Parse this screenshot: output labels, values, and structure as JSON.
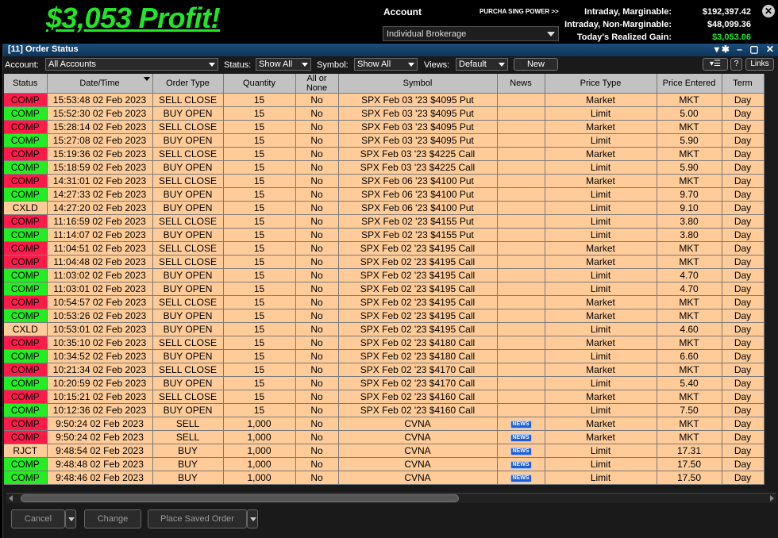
{
  "banner": {
    "profit_text": "$3,053 Profit!"
  },
  "account": {
    "title": "Account",
    "purchasing_power": "PURCHA SING POWER >>",
    "selected": "Individual Brokerage",
    "metrics": [
      {
        "label": "Intraday, Marginable:",
        "value": "$192,397.42"
      },
      {
        "label": "Intraday, Non-Marginable:",
        "value": "$48,099.36"
      },
      {
        "label": "Today's Realized Gain:",
        "value": "$3,053.06"
      }
    ]
  },
  "window": {
    "title": "[11] Order Status",
    "icons": "▾✱ – ▢ ✕"
  },
  "toolbar": {
    "account_label": "Account:",
    "account_value": "All Accounts",
    "status_label": "Status:",
    "status_value": "Show All",
    "symbol_label": "Symbol:",
    "symbol_value": "Show All",
    "views_label": "Views:",
    "views_value": "Default",
    "new_button": "New",
    "help_button": "?",
    "links_button": "Links"
  },
  "columns": [
    "Status",
    "Date/Time",
    "Order Type",
    "Quantity",
    "All or None",
    "Symbol",
    "News",
    "Price Type",
    "Price Entered",
    "Term"
  ],
  "rows": [
    {
      "status": "COMP",
      "color": "red",
      "time": "15:53:48 02 Feb 2023",
      "type": "SELL CLOSE",
      "qty": "15",
      "aon": "No",
      "symbol": "SPX Feb 03 '23 $4095 Put",
      "news": "",
      "ptype": "Market",
      "price": "MKT",
      "term": "Day"
    },
    {
      "status": "COMP",
      "color": "green",
      "time": "15:52:30 02 Feb 2023",
      "type": "BUY OPEN",
      "qty": "15",
      "aon": "No",
      "symbol": "SPX Feb 03 '23 $4095 Put",
      "news": "",
      "ptype": "Limit",
      "price": "5.00",
      "term": "Day"
    },
    {
      "status": "COMP",
      "color": "red",
      "time": "15:28:14 02 Feb 2023",
      "type": "SELL CLOSE",
      "qty": "15",
      "aon": "No",
      "symbol": "SPX Feb 03 '23 $4095 Put",
      "news": "",
      "ptype": "Market",
      "price": "MKT",
      "term": "Day"
    },
    {
      "status": "COMP",
      "color": "green",
      "time": "15:27:08 02 Feb 2023",
      "type": "BUY OPEN",
      "qty": "15",
      "aon": "No",
      "symbol": "SPX Feb 03 '23 $4095 Put",
      "news": "",
      "ptype": "Limit",
      "price": "5.90",
      "term": "Day"
    },
    {
      "status": "COMP",
      "color": "red",
      "time": "15:19:36 02 Feb 2023",
      "type": "SELL CLOSE",
      "qty": "15",
      "aon": "No",
      "symbol": "SPX Feb 03 '23 $4225 Call",
      "news": "",
      "ptype": "Market",
      "price": "MKT",
      "term": "Day"
    },
    {
      "status": "COMP",
      "color": "green",
      "time": "15:18:59 02 Feb 2023",
      "type": "BUY OPEN",
      "qty": "15",
      "aon": "No",
      "symbol": "SPX Feb 03 '23 $4225 Call",
      "news": "",
      "ptype": "Limit",
      "price": "5.90",
      "term": "Day"
    },
    {
      "status": "COMP",
      "color": "red",
      "time": "14:31:01 02 Feb 2023",
      "type": "SELL CLOSE",
      "qty": "15",
      "aon": "No",
      "symbol": "SPX Feb 06 '23 $4100 Put",
      "news": "",
      "ptype": "Market",
      "price": "MKT",
      "term": "Day"
    },
    {
      "status": "COMP",
      "color": "green",
      "time": "14:27:33 02 Feb 2023",
      "type": "BUY OPEN",
      "qty": "15",
      "aon": "No",
      "symbol": "SPX Feb 06 '23 $4100 Put",
      "news": "",
      "ptype": "Limit",
      "price": "9.70",
      "term": "Day"
    },
    {
      "status": "CXLD",
      "color": "none",
      "time": "14:27:20 02 Feb 2023",
      "type": "BUY OPEN",
      "qty": "15",
      "aon": "No",
      "symbol": "SPX Feb 06 '23 $4100 Put",
      "news": "",
      "ptype": "Limit",
      "price": "9.10",
      "term": "Day"
    },
    {
      "status": "COMP",
      "color": "red",
      "time": "11:16:59 02 Feb 2023",
      "type": "SELL CLOSE",
      "qty": "15",
      "aon": "No",
      "symbol": "SPX Feb 02 '23 $4155 Put",
      "news": "",
      "ptype": "Limit",
      "price": "3.80",
      "term": "Day"
    },
    {
      "status": "COMP",
      "color": "green",
      "time": "11:14:07 02 Feb 2023",
      "type": "BUY OPEN",
      "qty": "15",
      "aon": "No",
      "symbol": "SPX Feb 02 '23 $4155 Put",
      "news": "",
      "ptype": "Limit",
      "price": "3.80",
      "term": "Day"
    },
    {
      "status": "COMP",
      "color": "red",
      "time": "11:04:51 02 Feb 2023",
      "type": "SELL CLOSE",
      "qty": "15",
      "aon": "No",
      "symbol": "SPX Feb 02 '23 $4195 Call",
      "news": "",
      "ptype": "Market",
      "price": "MKT",
      "term": "Day"
    },
    {
      "status": "COMP",
      "color": "red",
      "time": "11:04:48 02 Feb 2023",
      "type": "SELL CLOSE",
      "qty": "15",
      "aon": "No",
      "symbol": "SPX Feb 02 '23 $4195 Call",
      "news": "",
      "ptype": "Market",
      "price": "MKT",
      "term": "Day"
    },
    {
      "status": "COMP",
      "color": "green",
      "time": "11:03:02 02 Feb 2023",
      "type": "BUY OPEN",
      "qty": "15",
      "aon": "No",
      "symbol": "SPX Feb 02 '23 $4195 Call",
      "news": "",
      "ptype": "Limit",
      "price": "4.70",
      "term": "Day"
    },
    {
      "status": "COMP",
      "color": "green",
      "time": "11:03:01 02 Feb 2023",
      "type": "BUY OPEN",
      "qty": "15",
      "aon": "No",
      "symbol": "SPX Feb 02 '23 $4195 Call",
      "news": "",
      "ptype": "Limit",
      "price": "4.70",
      "term": "Day"
    },
    {
      "status": "COMP",
      "color": "red",
      "time": "10:54:57 02 Feb 2023",
      "type": "SELL CLOSE",
      "qty": "15",
      "aon": "No",
      "symbol": "SPX Feb 02 '23 $4195 Call",
      "news": "",
      "ptype": "Market",
      "price": "MKT",
      "term": "Day"
    },
    {
      "status": "COMP",
      "color": "green",
      "time": "10:53:26 02 Feb 2023",
      "type": "BUY OPEN",
      "qty": "15",
      "aon": "No",
      "symbol": "SPX Feb 02 '23 $4195 Call",
      "news": "",
      "ptype": "Market",
      "price": "MKT",
      "term": "Day"
    },
    {
      "status": "CXLD",
      "color": "none",
      "time": "10:53:01 02 Feb 2023",
      "type": "BUY OPEN",
      "qty": "15",
      "aon": "No",
      "symbol": "SPX Feb 02 '23 $4195 Call",
      "news": "",
      "ptype": "Limit",
      "price": "4.60",
      "term": "Day"
    },
    {
      "status": "COMP",
      "color": "red",
      "time": "10:35:10 02 Feb 2023",
      "type": "SELL CLOSE",
      "qty": "15",
      "aon": "No",
      "symbol": "SPX Feb 02 '23 $4180 Call",
      "news": "",
      "ptype": "Market",
      "price": "MKT",
      "term": "Day"
    },
    {
      "status": "COMP",
      "color": "green",
      "time": "10:34:52 02 Feb 2023",
      "type": "BUY OPEN",
      "qty": "15",
      "aon": "No",
      "symbol": "SPX Feb 02 '23 $4180 Call",
      "news": "",
      "ptype": "Limit",
      "price": "6.60",
      "term": "Day"
    },
    {
      "status": "COMP",
      "color": "red",
      "time": "10:21:34 02 Feb 2023",
      "type": "SELL CLOSE",
      "qty": "15",
      "aon": "No",
      "symbol": "SPX Feb 02 '23 $4170 Call",
      "news": "",
      "ptype": "Market",
      "price": "MKT",
      "term": "Day"
    },
    {
      "status": "COMP",
      "color": "green",
      "time": "10:20:59 02 Feb 2023",
      "type": "BUY OPEN",
      "qty": "15",
      "aon": "No",
      "symbol": "SPX Feb 02 '23 $4170 Call",
      "news": "",
      "ptype": "Limit",
      "price": "5.40",
      "term": "Day"
    },
    {
      "status": "COMP",
      "color": "red",
      "time": "10:15:21 02 Feb 2023",
      "type": "SELL CLOSE",
      "qty": "15",
      "aon": "No",
      "symbol": "SPX Feb 02 '23 $4160 Call",
      "news": "",
      "ptype": "Market",
      "price": "MKT",
      "term": "Day"
    },
    {
      "status": "COMP",
      "color": "green",
      "time": "10:12:36 02 Feb 2023",
      "type": "BUY OPEN",
      "qty": "15",
      "aon": "No",
      "symbol": "SPX Feb 02 '23 $4160 Call",
      "news": "",
      "ptype": "Limit",
      "price": "7.50",
      "term": "Day"
    },
    {
      "status": "COMP",
      "color": "red",
      "time": "9:50:24 02 Feb 2023",
      "type": "SELL",
      "qty": "1,000",
      "aon": "No",
      "symbol": "CVNA",
      "news": "NEWS",
      "ptype": "Market",
      "price": "MKT",
      "term": "Day"
    },
    {
      "status": "COMP",
      "color": "red",
      "time": "9:50:24 02 Feb 2023",
      "type": "SELL",
      "qty": "1,000",
      "aon": "No",
      "symbol": "CVNA",
      "news": "NEWS",
      "ptype": "Market",
      "price": "MKT",
      "term": "Day"
    },
    {
      "status": "RJCT",
      "color": "none",
      "time": "9:48:54 02 Feb 2023",
      "type": "BUY",
      "qty": "1,000",
      "aon": "No",
      "symbol": "CVNA",
      "news": "NEWS",
      "ptype": "Limit",
      "price": "17.31",
      "term": "Day"
    },
    {
      "status": "COMP",
      "color": "green",
      "time": "9:48:48 02 Feb 2023",
      "type": "BUY",
      "qty": "1,000",
      "aon": "No",
      "symbol": "CVNA",
      "news": "NEWS",
      "ptype": "Limit",
      "price": "17.50",
      "term": "Day"
    },
    {
      "status": "COMP",
      "color": "green",
      "time": "9:48:46 02 Feb 2023",
      "type": "BUY",
      "qty": "1,000",
      "aon": "No",
      "symbol": "CVNA",
      "news": "NEWS",
      "ptype": "Limit",
      "price": "17.50",
      "term": "Day"
    }
  ],
  "footer": {
    "cancel": "Cancel",
    "change": "Change",
    "place_saved": "Place Saved Order"
  },
  "colors": {
    "row_bg": "#ffcc99",
    "comp_sell": "#ff1a4a",
    "comp_buy": "#22ee22",
    "profit": "#22e52a",
    "title_bar": "#0e3458"
  }
}
